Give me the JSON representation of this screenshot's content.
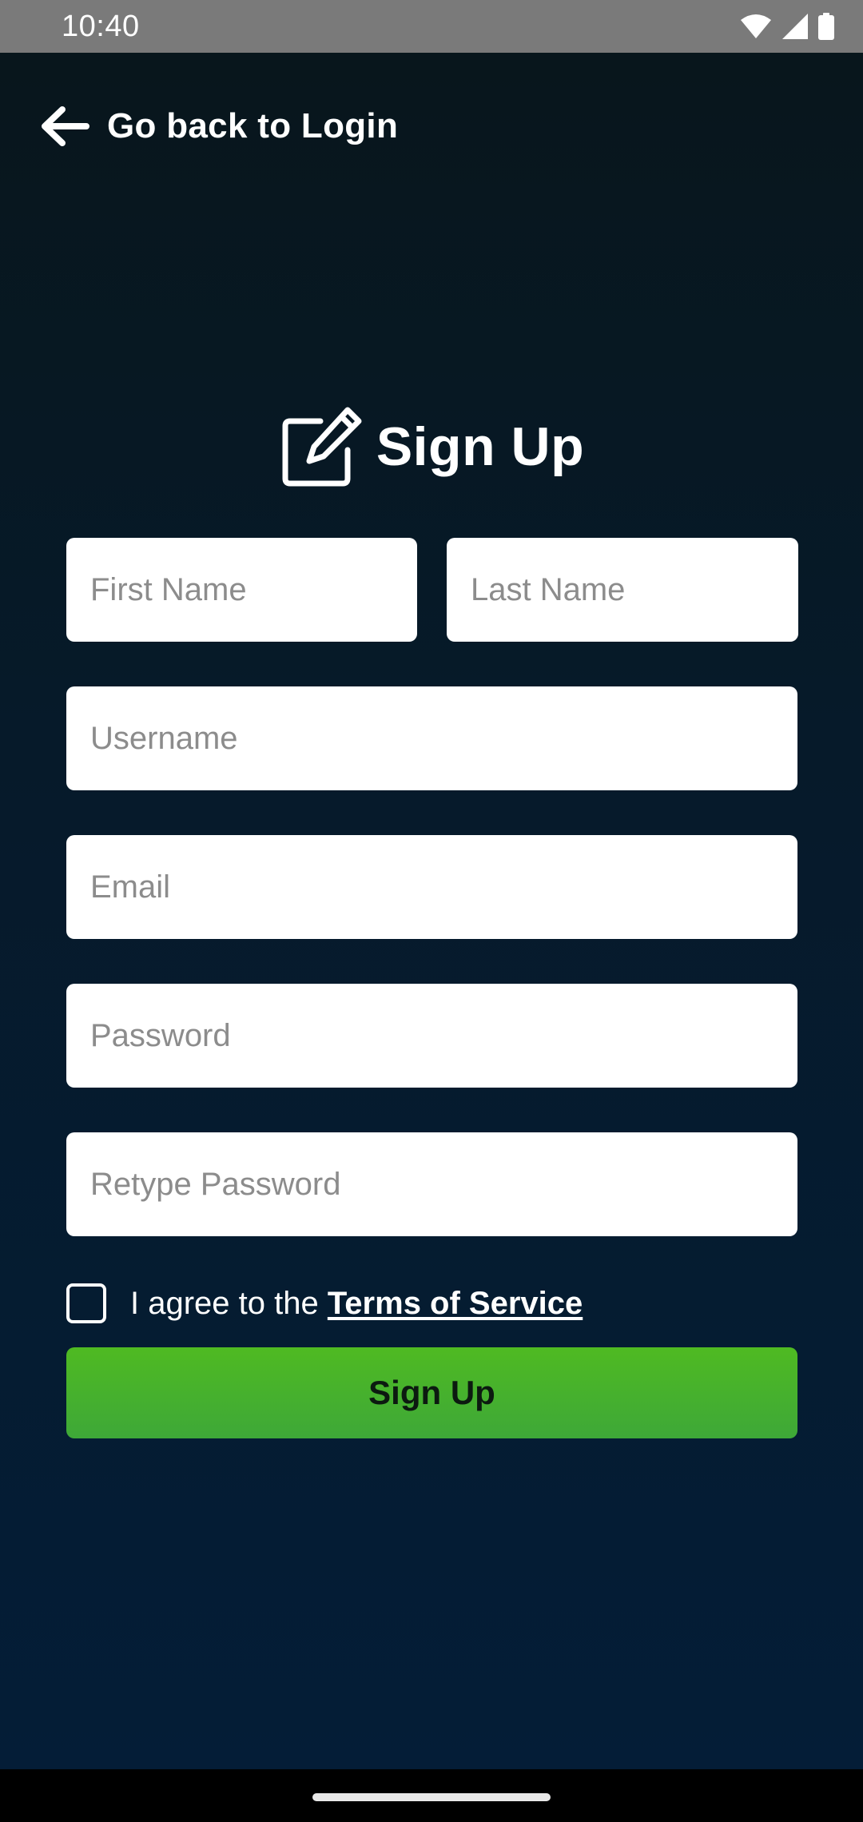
{
  "status_bar": {
    "time": "10:40",
    "icons": [
      "wifi-icon",
      "cell-signal-icon",
      "battery-icon"
    ]
  },
  "header": {
    "back_label": "Go back to Login",
    "back_icon": "arrow-left-icon"
  },
  "title": {
    "text": "Sign Up",
    "icon": "edit-icon"
  },
  "form": {
    "first_name_placeholder": "First Name",
    "last_name_placeholder": "Last Name",
    "username_placeholder": "Username",
    "email_placeholder": "Email",
    "password_placeholder": "Password",
    "retype_password_placeholder": "Retype Password",
    "agree_text": "I agree to the ",
    "terms_link": "Terms of Service",
    "submit_label": "Sign Up"
  },
  "colors": {
    "background_top": "#08161c",
    "background_bottom": "#041d37",
    "accent_green": "#4fba22",
    "status_bar": "#7a7a7a"
  }
}
